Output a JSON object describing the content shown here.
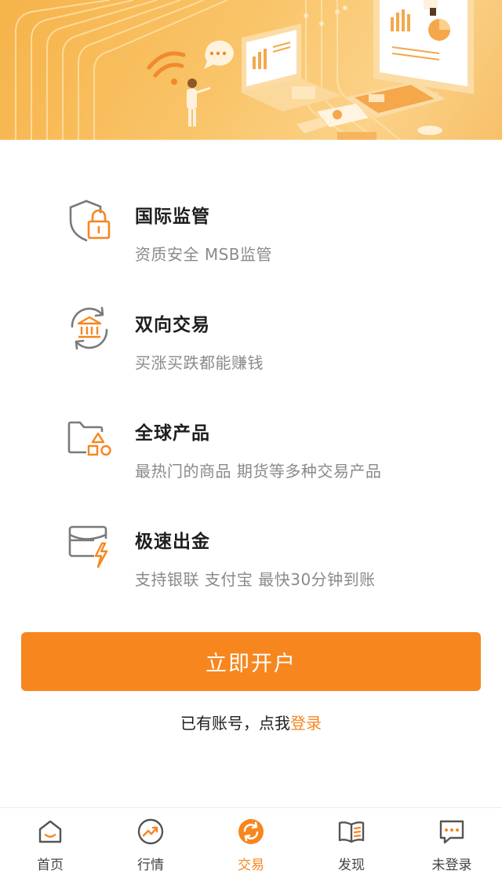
{
  "colors": {
    "accent": "#f7861f",
    "icon_gray": "#7a7a7a",
    "title_text": "#1e1e1e",
    "desc_text": "#8a8a8a",
    "banner": "#f9c468"
  },
  "features": [
    {
      "icon": "shield-lock-icon",
      "title": "国际监管",
      "desc": "资质安全 MSB监管"
    },
    {
      "icon": "bank-sync-icon",
      "title": "双向交易",
      "desc": "买涨买跌都能赚钱"
    },
    {
      "icon": "folder-shapes-icon",
      "title": "全球产品",
      "desc": "最热门的商品 期货等多种交易产品"
    },
    {
      "icon": "card-lightning-icon",
      "title": "极速出金",
      "desc": "支持银联 支付宝 最快30分钟到账"
    }
  ],
  "cta": {
    "label": "立即开户"
  },
  "login": {
    "prompt": "已有账号，点我",
    "link": "登录"
  },
  "tabbar": {
    "active": "交易",
    "tabs": [
      {
        "label": "首页",
        "icon": "home-icon"
      },
      {
        "label": "行情",
        "icon": "trend-icon"
      },
      {
        "label": "交易",
        "icon": "exchange-icon"
      },
      {
        "label": "发现",
        "icon": "book-icon"
      },
      {
        "label": "未登录",
        "icon": "chat-dots-icon"
      }
    ]
  }
}
